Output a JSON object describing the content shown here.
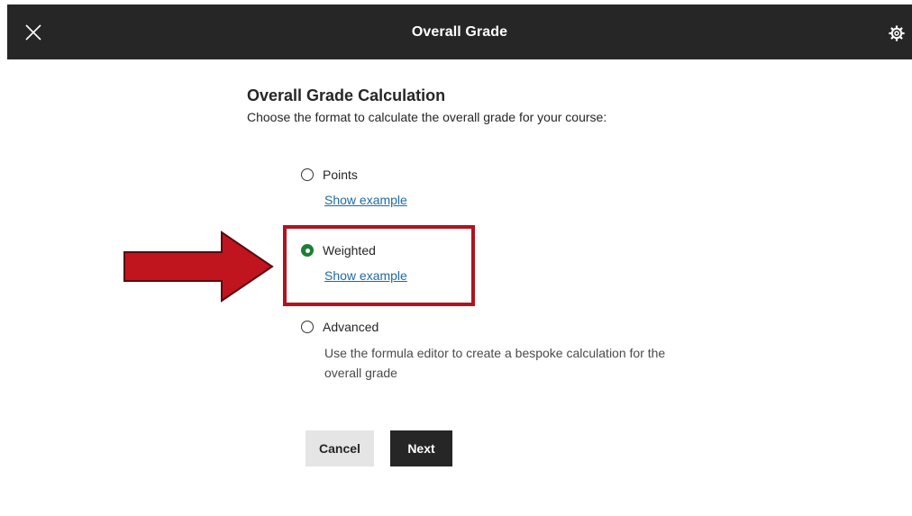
{
  "header": {
    "title": "Overall Grade",
    "close_icon": "close-icon",
    "settings_icon": "gear-icon"
  },
  "calculation": {
    "title": "Overall Grade Calculation",
    "subtitle": "Choose the format to calculate the overall grade for your course:"
  },
  "options": [
    {
      "label": "Points",
      "selected": false,
      "link": "Show example"
    },
    {
      "label": "Weighted",
      "selected": true,
      "link": "Show example"
    },
    {
      "label": "Advanced",
      "selected": false,
      "description": "Use the formula editor to create a bespoke calculation for the overall grade"
    }
  ],
  "buttons": {
    "cancel": "Cancel",
    "next": "Next"
  },
  "colors": {
    "header_bg": "#262626",
    "selected_radio": "#1e7e34",
    "link": "#1f6aa5",
    "annotation": "#b0131e"
  }
}
